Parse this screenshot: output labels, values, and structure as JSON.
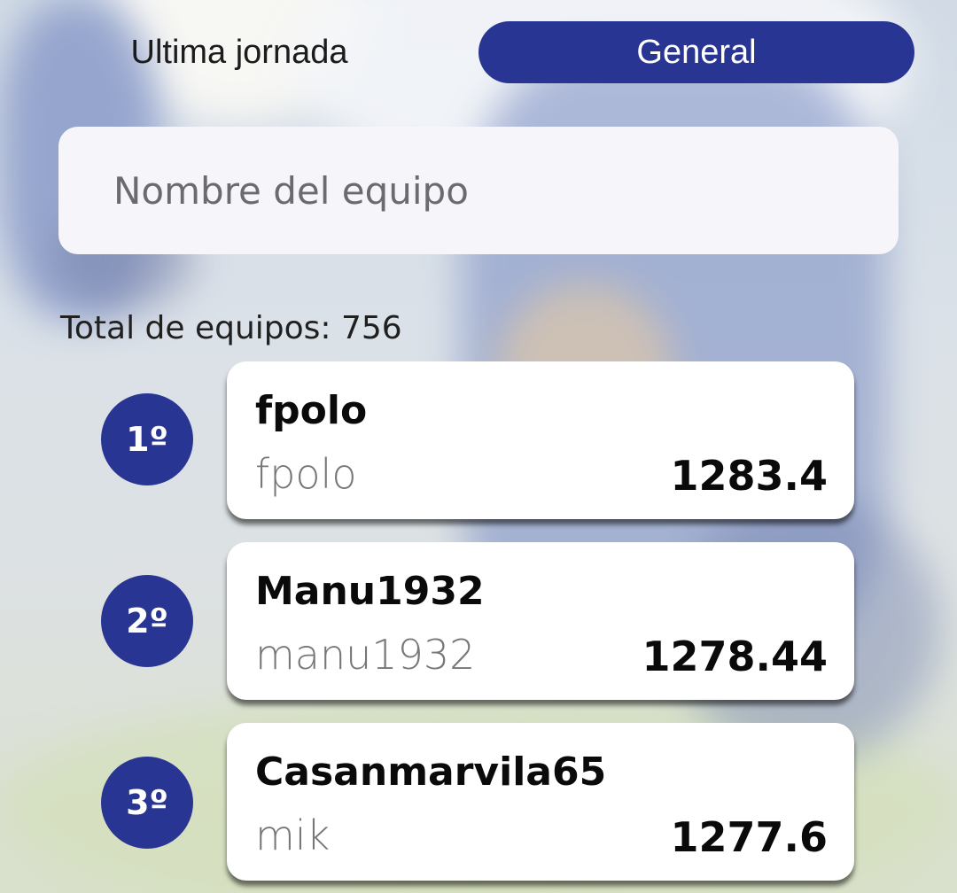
{
  "tabs": {
    "last_round_label": "Ultima jornada",
    "general_label": "General",
    "active": "General"
  },
  "search": {
    "placeholder": "Nombre del equipo",
    "value": ""
  },
  "total_teams_text": "Total de equipos: 756",
  "rankings": [
    {
      "position": "1º",
      "team": "fpolo",
      "user": "fpolo",
      "points": "1283.4"
    },
    {
      "position": "2º",
      "team": "Manu1932",
      "user": "manu1932",
      "points": "1278.44"
    },
    {
      "position": "3º",
      "team": "Casanmarvila65",
      "user": "mik",
      "points": "1277.6"
    }
  ],
  "colors": {
    "accent": "#283593",
    "card": "#ffffff",
    "search_bg": "#f6f6fa"
  }
}
